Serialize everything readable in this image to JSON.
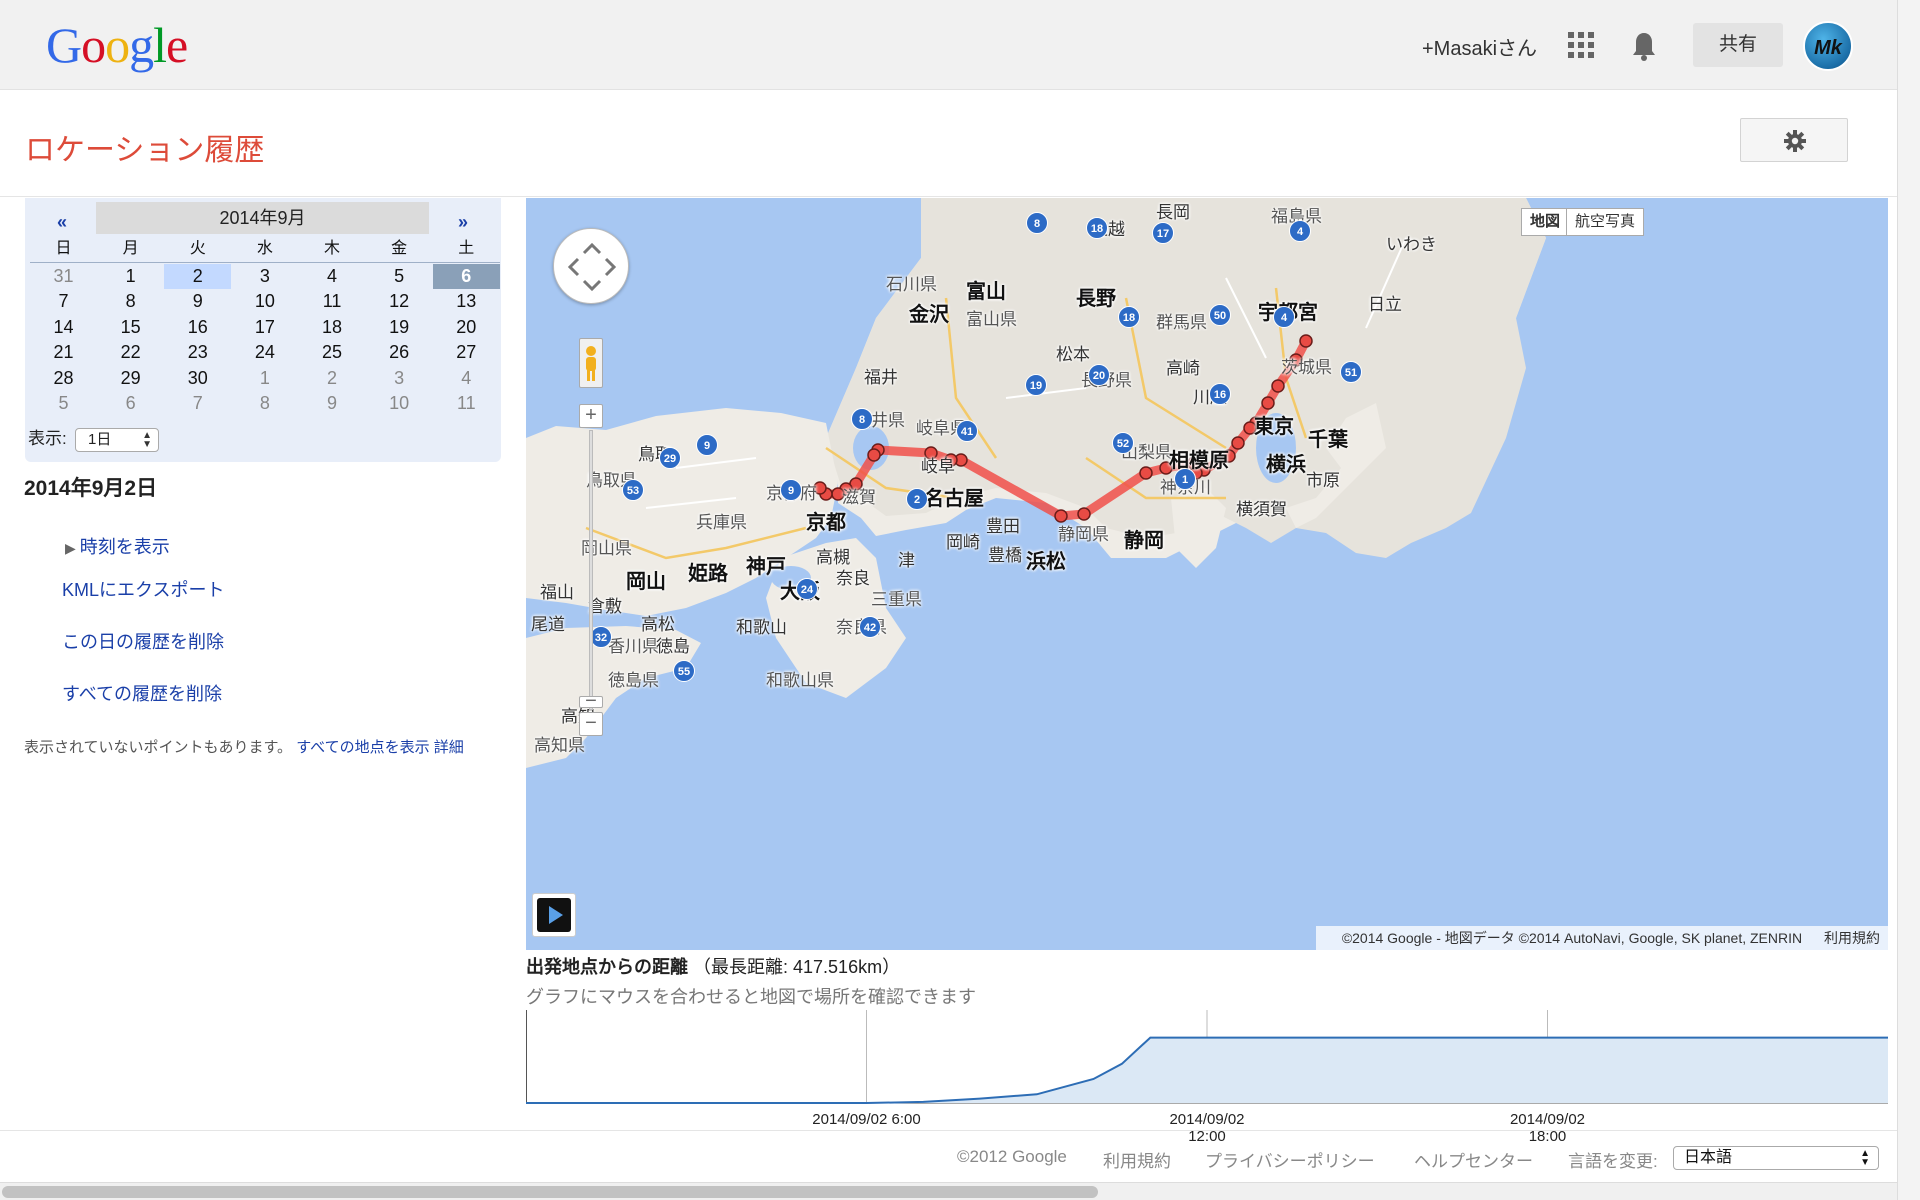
{
  "header": {
    "logo_letters": [
      {
        "ch": "G",
        "color": "#3369e8"
      },
      {
        "ch": "o",
        "color": "#d50f25"
      },
      {
        "ch": "o",
        "color": "#eeb211"
      },
      {
        "ch": "g",
        "color": "#3369e8"
      },
      {
        "ch": "l",
        "color": "#009925"
      },
      {
        "ch": "e",
        "color": "#d50f25"
      }
    ],
    "user_label": "+Masakiさん",
    "share_label": "共有",
    "avatar_initials": "Mk"
  },
  "page": {
    "title": "ロケーション履歴",
    "accent_color": "#dd4b39"
  },
  "calendar": {
    "prev": "«",
    "next": "»",
    "month_label": "2014年9月",
    "weekdays": [
      "日",
      "月",
      "火",
      "水",
      "木",
      "金",
      "土"
    ],
    "weeks": [
      [
        {
          "d": "31",
          "s": "muted"
        },
        {
          "d": "1"
        },
        {
          "d": "2",
          "s": "sel"
        },
        {
          "d": "3"
        },
        {
          "d": "4"
        },
        {
          "d": "5"
        },
        {
          "d": "6",
          "s": "today"
        }
      ],
      [
        {
          "d": "7"
        },
        {
          "d": "8"
        },
        {
          "d": "9"
        },
        {
          "d": "10"
        },
        {
          "d": "11"
        },
        {
          "d": "12"
        },
        {
          "d": "13"
        }
      ],
      [
        {
          "d": "14"
        },
        {
          "d": "15"
        },
        {
          "d": "16"
        },
        {
          "d": "17"
        },
        {
          "d": "18"
        },
        {
          "d": "19"
        },
        {
          "d": "20"
        }
      ],
      [
        {
          "d": "21"
        },
        {
          "d": "22"
        },
        {
          "d": "23"
        },
        {
          "d": "24"
        },
        {
          "d": "25"
        },
        {
          "d": "26"
        },
        {
          "d": "27"
        }
      ],
      [
        {
          "d": "28"
        },
        {
          "d": "29"
        },
        {
          "d": "30"
        },
        {
          "d": "1",
          "s": "muted"
        },
        {
          "d": "2",
          "s": "muted"
        },
        {
          "d": "3",
          "s": "muted"
        },
        {
          "d": "4",
          "s": "muted"
        }
      ],
      [
        {
          "d": "5",
          "s": "muted"
        },
        {
          "d": "6",
          "s": "muted"
        },
        {
          "d": "7",
          "s": "muted"
        },
        {
          "d": "8",
          "s": "muted"
        },
        {
          "d": "9",
          "s": "muted"
        },
        {
          "d": "10",
          "s": "muted"
        },
        {
          "d": "11",
          "s": "muted"
        }
      ]
    ],
    "view_label": "表示:",
    "view_value": "1日"
  },
  "sidebar": {
    "date_heading": "2014年9月2日",
    "show_time": "時刻を表示",
    "export_kml": "KMLにエクスポート",
    "delete_day": "この日の履歴を削除",
    "delete_all": "すべての履歴を削除",
    "note_text": "表示されていないポイントもあります。",
    "note_link_all": "すべての地点を表示",
    "note_link_detail": "詳細"
  },
  "map": {
    "type_map": "地図",
    "type_satellite": "航空写真",
    "attribution": "©2014 Google - 地図データ ©2014 AutoNavi, Google, SK planet, ZENRIN",
    "terms": "利用規約",
    "route_color": "#f0504a",
    "labels": [
      {
        "t": "長岡",
        "c": ""
      },
      {
        "t": "福島県",
        "c": "pref"
      },
      {
        "t": "上越",
        "c": ""
      },
      {
        "t": "いわき",
        "c": ""
      },
      {
        "t": "石川県",
        "c": "pref"
      },
      {
        "t": "富山",
        "c": "big"
      },
      {
        "t": "長野",
        "c": "big"
      },
      {
        "t": "宇都宮",
        "c": "big"
      },
      {
        "t": "金沢",
        "c": "big"
      },
      {
        "t": "富山県",
        "c": "pref"
      },
      {
        "t": "群馬県",
        "c": "pref"
      },
      {
        "t": "日立",
        "c": ""
      },
      {
        "t": "松本",
        "c": ""
      },
      {
        "t": "福井",
        "c": ""
      },
      {
        "t": "高崎",
        "c": ""
      },
      {
        "t": "茨城県",
        "c": "pref"
      },
      {
        "t": "長野県",
        "c": "pref"
      },
      {
        "t": "川越",
        "c": ""
      },
      {
        "t": "福井県",
        "c": "pref"
      },
      {
        "t": "岐阜県",
        "c": "pref"
      },
      {
        "t": "東京",
        "c": "big"
      },
      {
        "t": "千葉",
        "c": "big"
      },
      {
        "t": "鳥取",
        "c": ""
      },
      {
        "t": "山梨県",
        "c": "pref"
      },
      {
        "t": "相模原",
        "c": "big"
      },
      {
        "t": "横浜",
        "c": "big"
      },
      {
        "t": "岐阜",
        "c": ""
      },
      {
        "t": "鳥取県",
        "c": "pref"
      },
      {
        "t": "市原",
        "c": ""
      },
      {
        "t": "京都府",
        "c": "pref"
      },
      {
        "t": "滋賀",
        "c": "pref"
      },
      {
        "t": "名古屋",
        "c": "big"
      },
      {
        "t": "神奈川",
        "c": "pref"
      },
      {
        "t": "横須賀",
        "c": ""
      },
      {
        "t": "兵庫県",
        "c": "pref"
      },
      {
        "t": "京都",
        "c": "big"
      },
      {
        "t": "豊田",
        "c": ""
      },
      {
        "t": "静岡県",
        "c": "pref"
      },
      {
        "t": "岡山県",
        "c": "pref"
      },
      {
        "t": "岡崎",
        "c": ""
      },
      {
        "t": "静岡",
        "c": "big"
      },
      {
        "t": "姫路",
        "c": "big"
      },
      {
        "t": "神戸",
        "c": "big"
      },
      {
        "t": "高槻",
        "c": ""
      },
      {
        "t": "津",
        "c": ""
      },
      {
        "t": "豊橋",
        "c": ""
      },
      {
        "t": "浜松",
        "c": "big"
      },
      {
        "t": "岡山",
        "c": "big"
      },
      {
        "t": "大阪",
        "c": "big"
      },
      {
        "t": "奈良",
        "c": ""
      },
      {
        "t": "福山",
        "c": ""
      },
      {
        "t": "三重県",
        "c": "pref"
      },
      {
        "t": "倉敷",
        "c": ""
      },
      {
        "t": "高松",
        "c": ""
      },
      {
        "t": "和歌山",
        "c": ""
      },
      {
        "t": "奈良県",
        "c": "pref"
      },
      {
        "t": "香川県",
        "c": "pref"
      },
      {
        "t": "徳島",
        "c": ""
      },
      {
        "t": "徳島県",
        "c": "pref"
      },
      {
        "t": "和歌山県",
        "c": "pref"
      },
      {
        "t": "高知",
        "c": ""
      },
      {
        "t": "高知県",
        "c": "pref"
      },
      {
        "t": "尾道",
        "c": ""
      }
    ],
    "shields": [
      "8",
      "18",
      "17",
      "4",
      "8",
      "18",
      "50",
      "4",
      "19",
      "20",
      "51",
      "16",
      "41",
      "8",
      "9",
      "29",
      "52",
      "1",
      "53",
      "9",
      "2",
      "24",
      "32",
      "42",
      "55"
    ]
  },
  "graph": {
    "title": "出発地点からの距離",
    "subtitle": "（最長距離: 417.516km）",
    "hint": "グラフにマウスを合わせると地図で場所を確認できます",
    "line_color": "#2d6db5",
    "fill_color": "#dbe8f5",
    "ticks": [
      {
        "l1": "2014/09/02 6:00",
        "l2": ""
      },
      {
        "l1": "2014/09/02",
        "l2": "12:00"
      },
      {
        "l1": "2014/09/02",
        "l2": "18:00"
      }
    ]
  },
  "chart_data": {
    "type": "area",
    "title": "出発地点からの距離",
    "x": [
      "0:00",
      "6:00",
      "7:00",
      "8:00",
      "9:00",
      "10:00",
      "10:30",
      "11:00",
      "12:00",
      "18:00",
      "24:00"
    ],
    "series": [
      {
        "values": [
          0,
          0,
          5,
          20,
          40,
          110,
          180,
          300,
          300,
          300,
          300
        ]
      }
    ],
    "ylim": [
      0,
      417.516
    ],
    "grid": true
  },
  "footer": {
    "copyright": "©2012 Google",
    "terms": "利用規約",
    "privacy": "プライバシーポリシー",
    "help": "ヘルプセンター",
    "language_label": "言語を変更:",
    "language_value": "日本語"
  }
}
